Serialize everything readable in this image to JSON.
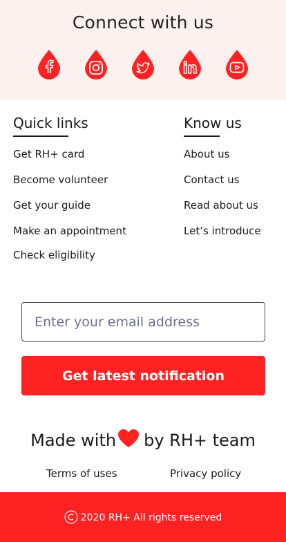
{
  "connect": {
    "title": "Connect with us",
    "accent": "#ff2222",
    "background": "#fdf1ef",
    "social": [
      {
        "icon": "facebook-icon"
      },
      {
        "icon": "instagram-icon"
      },
      {
        "icon": "twitter-icon"
      },
      {
        "icon": "linkedin-icon"
      },
      {
        "icon": "youtube-icon"
      }
    ]
  },
  "quick_links": {
    "heading": "Quick links",
    "items": [
      "Get RH+ card",
      "Become volunteer",
      "Get your guide",
      "Make an appointment",
      "Check eligibility"
    ]
  },
  "know_us": {
    "heading": "Know us",
    "items": [
      "About us",
      "Contact us",
      "Read about us",
      "Let’s introduce"
    ]
  },
  "subscribe": {
    "email_placeholder": "Enter your email address",
    "email_value": "",
    "button_label": "Get latest notification"
  },
  "made_with": {
    "before": "Made with",
    "after": "by RH+ team",
    "icon": "heart-icon"
  },
  "legal": {
    "terms": "Terms of uses",
    "privacy": "Privacy policy"
  },
  "footer": {
    "copyright_text": "2020 RH+ All rights reserved",
    "icon": "copyright-icon",
    "background": "#ff2222"
  }
}
